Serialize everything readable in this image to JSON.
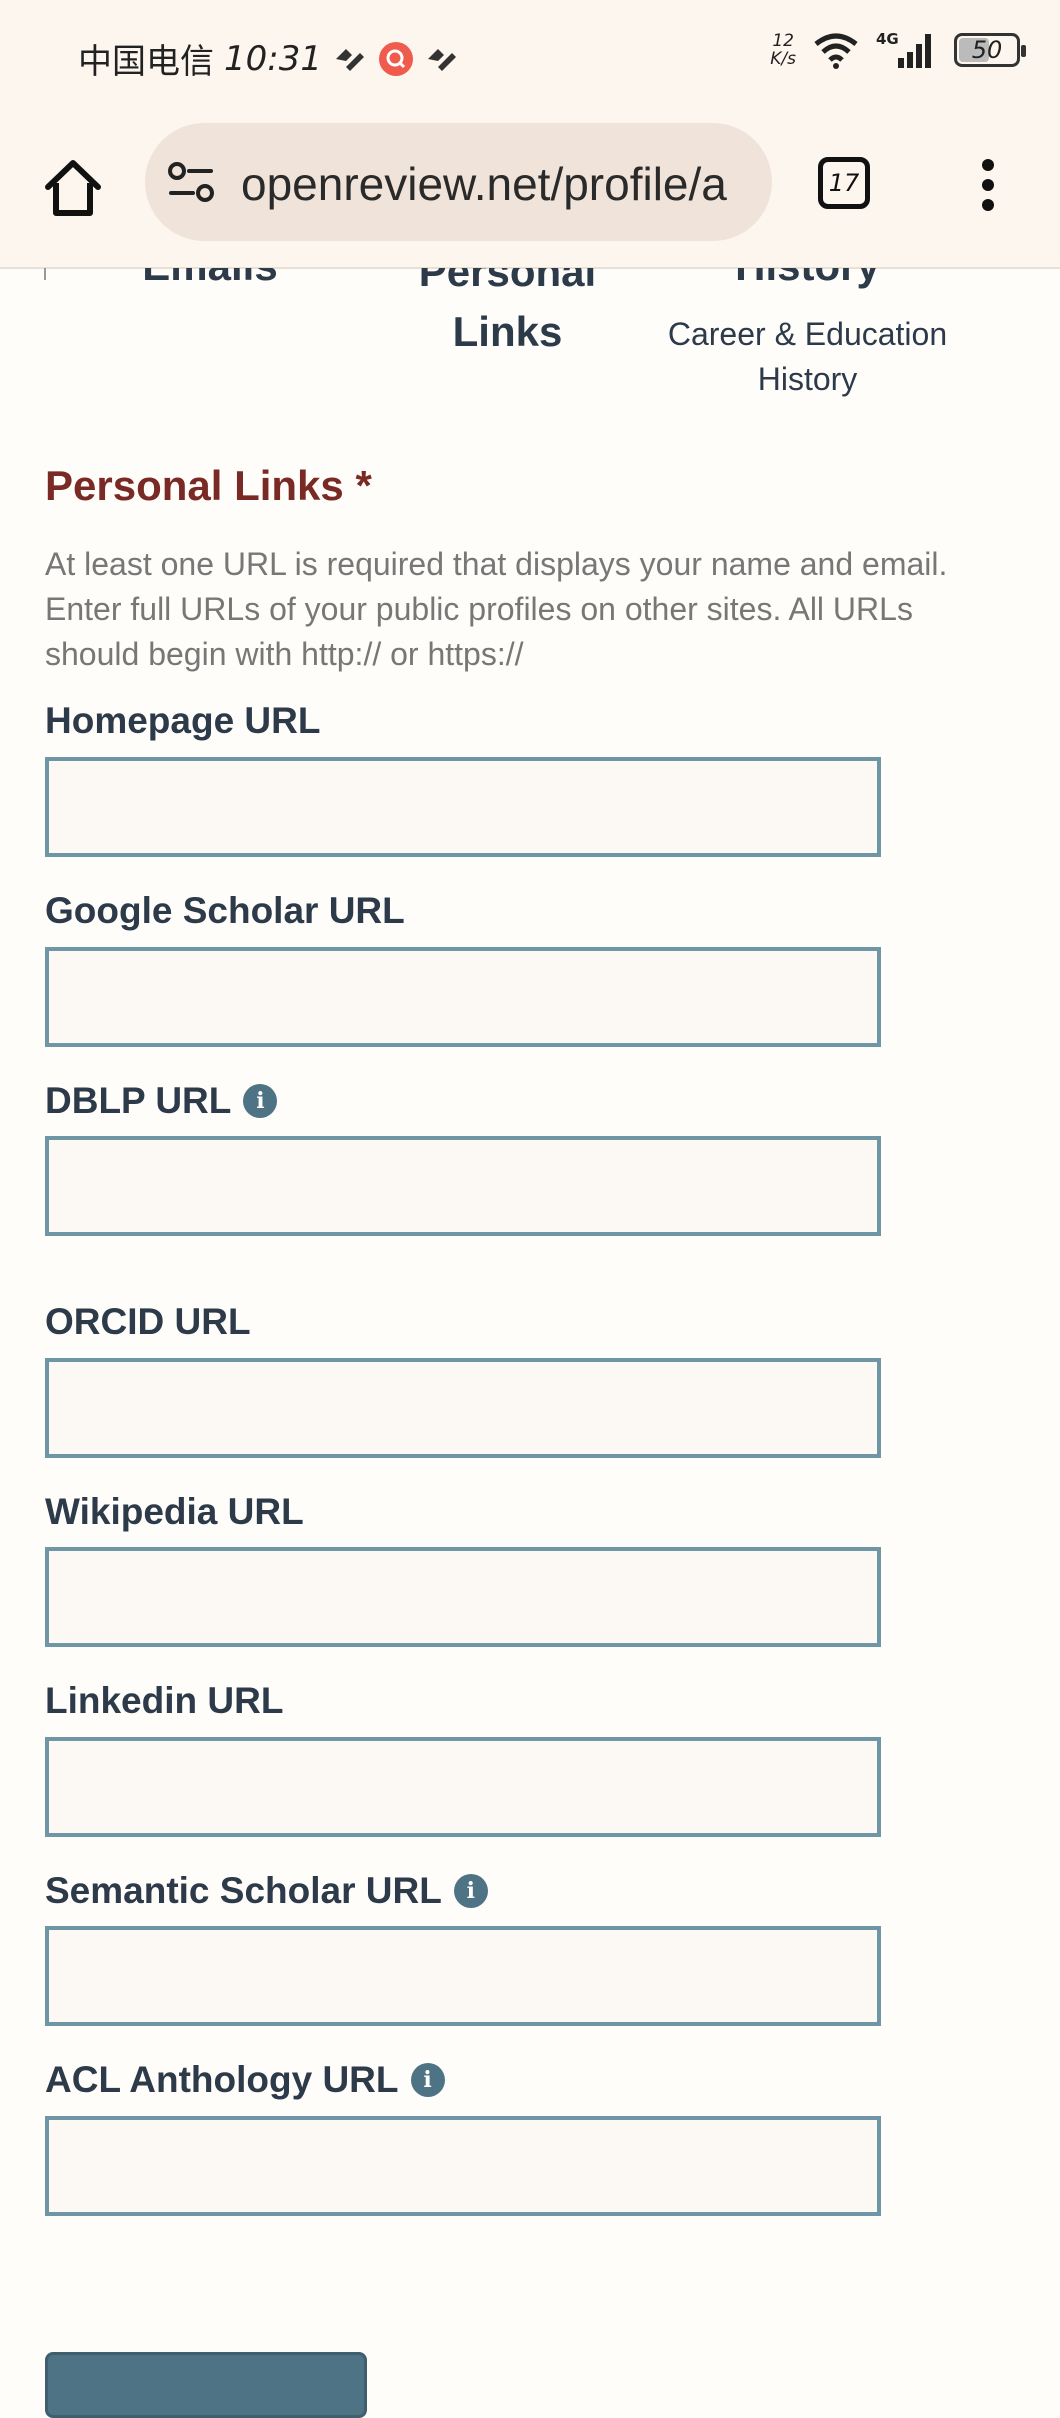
{
  "status_bar": {
    "carrier": "中国电信",
    "time": "10:31",
    "speed_value": "12",
    "speed_unit": "K/s",
    "battery": "50"
  },
  "browser": {
    "url": "openreview.net/profile/a",
    "tab_count": "17"
  },
  "profile_tabs": [
    {
      "title": "Emails"
    },
    {
      "title": "Personal Links"
    },
    {
      "title": "History",
      "subtitle": "Career & Education History"
    }
  ],
  "section": {
    "title": "Personal Links *",
    "help": "At least one URL is required that displays your name and email. Enter full URLs of your public profiles on other sites. All URLs should begin with http:// or https://"
  },
  "fields": [
    {
      "label": "Homepage URL",
      "value": ""
    },
    {
      "label": "Google Scholar URL",
      "value": ""
    },
    {
      "label": "DBLP URL",
      "value": ""
    },
    {
      "label": "ORCID URL",
      "value": ""
    },
    {
      "label": "Wikipedia URL",
      "value": ""
    },
    {
      "label": "Linkedin URL",
      "value": ""
    },
    {
      "label": "Semantic Scholar URL",
      "value": ""
    },
    {
      "label": "ACL Anthology URL",
      "value": ""
    }
  ],
  "colors": {
    "section_title": "#7a2a24",
    "input_border": "#6f96a4",
    "info_icon": "#4e7385"
  }
}
